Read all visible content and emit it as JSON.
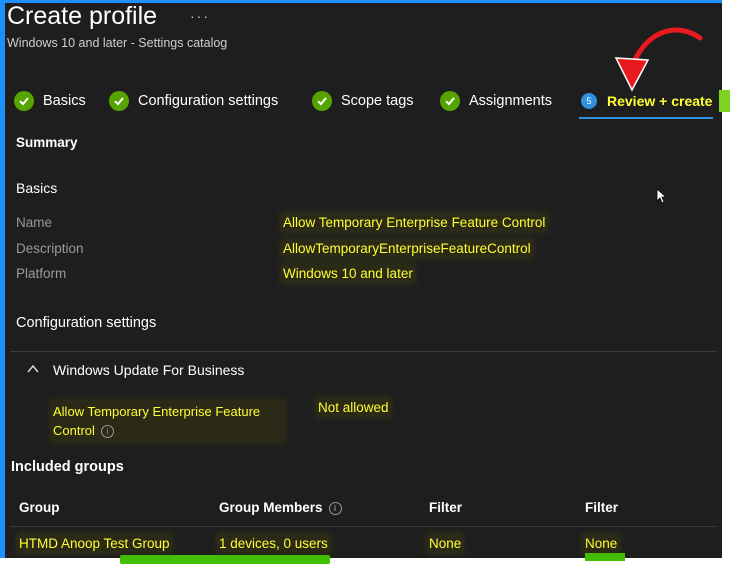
{
  "header": {
    "title": "Create profile",
    "more_label": "···",
    "subtitle": "Windows 10 and later - Settings catalog"
  },
  "steps": [
    {
      "label": "Basics",
      "state": "complete"
    },
    {
      "label": "Configuration settings",
      "state": "complete"
    },
    {
      "label": "Scope tags",
      "state": "complete"
    },
    {
      "label": "Assignments",
      "state": "complete"
    },
    {
      "number": "5",
      "label": "Review + create",
      "state": "active"
    }
  ],
  "summary": {
    "heading": "Summary",
    "basics": {
      "heading": "Basics",
      "rows": [
        {
          "label": "Name",
          "value": "Allow Temporary Enterprise Feature Control"
        },
        {
          "label": "Description",
          "value": "AllowTemporaryEnterpriseFeatureControl"
        },
        {
          "label": "Platform",
          "value": "Windows 10 and later"
        }
      ]
    },
    "configuration": {
      "heading": "Configuration settings",
      "category": "Windows Update For Business",
      "setting_name": "Allow Temporary Enterprise Feature Control",
      "setting_value": "Not allowed"
    },
    "groups": {
      "heading": "Included groups",
      "columns": [
        "Group",
        "Group Members",
        "Filter",
        "Filter"
      ],
      "rows": [
        [
          "HTMD Anoop Test Group",
          "1 devices, 0 users",
          "None",
          "None"
        ]
      ]
    }
  },
  "colors": {
    "background": "#1e1e1e",
    "highlight_text": "#ffff33",
    "check_green": "#57a300",
    "accent_blue": "#2f8fe0",
    "frame_blue": "#1e8fff",
    "annotation_red": "#e8191f"
  }
}
